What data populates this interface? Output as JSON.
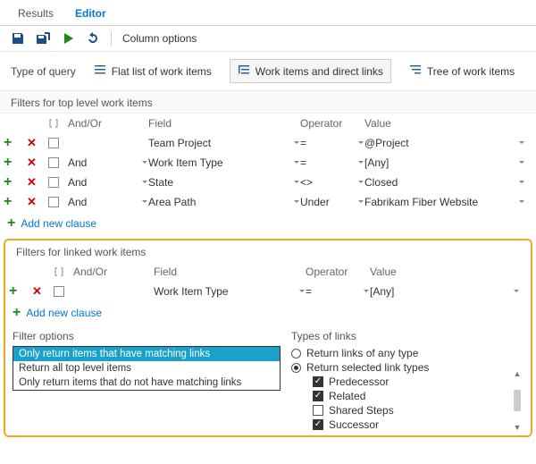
{
  "tabs": {
    "results": "Results",
    "editor": "Editor",
    "active": "editor"
  },
  "toolbar": {
    "column_options": "Column options"
  },
  "query_type": {
    "label": "Type of query",
    "flat": "Flat list of work items",
    "direct": "Work items and direct links",
    "tree": "Tree of work items",
    "selected": "direct"
  },
  "filters_top": {
    "header": "Filters for top level work items",
    "columns": {
      "andor": "And/Or",
      "field": "Field",
      "operator": "Operator",
      "value": "Value"
    },
    "rows": [
      {
        "andor": "",
        "field": "Team Project",
        "operator": "=",
        "value": "@Project"
      },
      {
        "andor": "And",
        "field": "Work Item Type",
        "operator": "=",
        "value": "[Any]"
      },
      {
        "andor": "And",
        "field": "State",
        "operator": "<>",
        "value": "Closed"
      },
      {
        "andor": "And",
        "field": "Area Path",
        "operator": "Under",
        "value": "Fabrikam Fiber Website"
      }
    ],
    "add": "Add new clause"
  },
  "filters_linked": {
    "header": "Filters for linked work items",
    "rows": [
      {
        "andor": "",
        "field": "Work Item Type",
        "operator": "=",
        "value": "[Any]"
      }
    ],
    "add": "Add new clause"
  },
  "filter_options": {
    "header": "Filter options",
    "items": [
      "Only return items that have matching links",
      "Return all top level items",
      "Only return items that do not have matching links"
    ],
    "selected": 0
  },
  "types_of_links": {
    "header": "Types of links",
    "any": "Return links of any type",
    "selected_label": "Return selected link types",
    "mode": "selected",
    "types": [
      {
        "name": "Predecessor",
        "checked": true
      },
      {
        "name": "Related",
        "checked": true
      },
      {
        "name": "Shared Steps",
        "checked": false
      },
      {
        "name": "Successor",
        "checked": true
      }
    ]
  }
}
